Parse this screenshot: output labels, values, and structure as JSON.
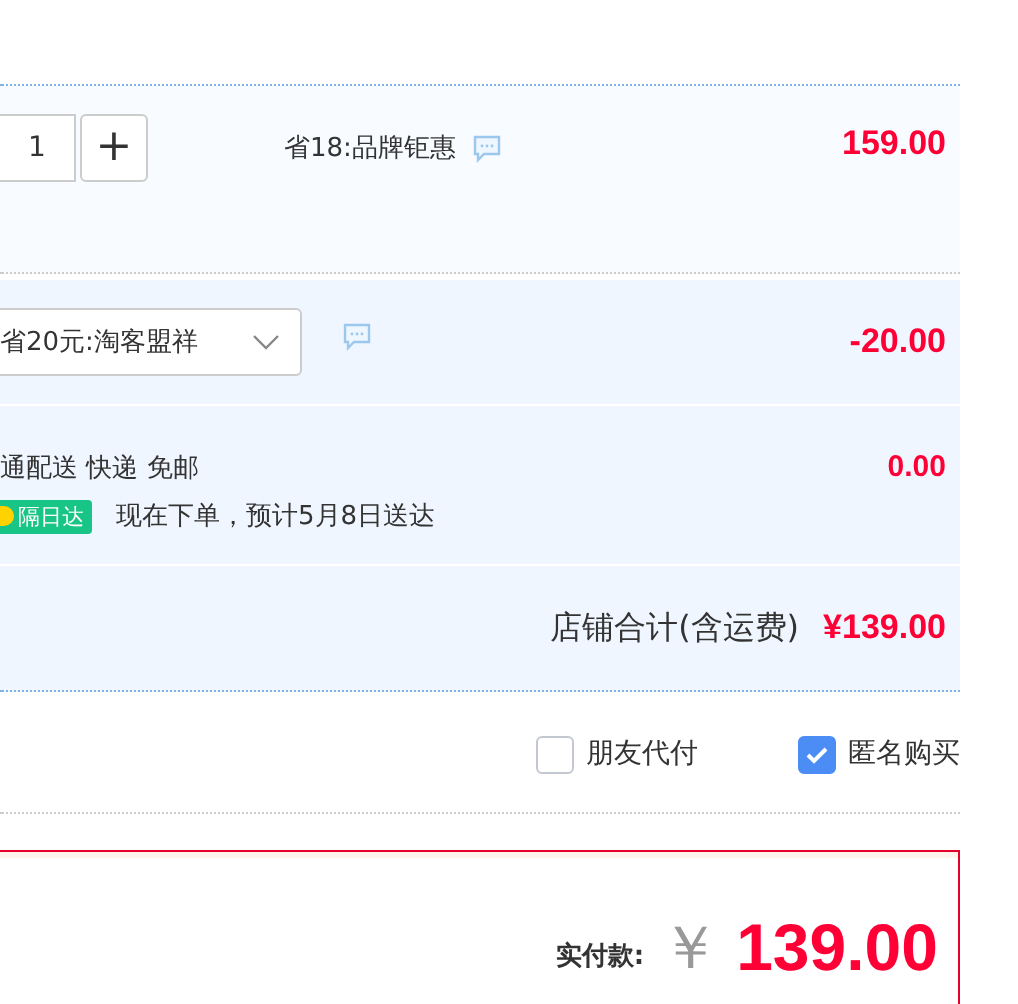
{
  "item": {
    "quantity": "1",
    "plus": "+",
    "promo": "省18:品牌钜惠",
    "price": "159.00"
  },
  "coupon": {
    "value": "省20元:淘客盟祥",
    "amount": "-20.00"
  },
  "shipping": {
    "method": "通配送 快递 免邮",
    "badge": "隔日达",
    "eta": "现在下单，预计5月8日送达",
    "fee": "0.00"
  },
  "shop_total": {
    "label": "店铺合计(含运费)",
    "amount": "¥139.00"
  },
  "options": [
    {
      "label": "朋友代付",
      "checked": false
    },
    {
      "label": "匿名购买",
      "checked": true
    }
  ],
  "payment": {
    "label": "实付款:",
    "currency": "￥",
    "amount": "139.00"
  }
}
